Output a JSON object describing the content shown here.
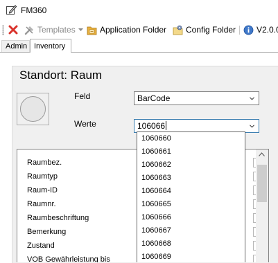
{
  "window": {
    "title": "FM360"
  },
  "toolbar": {
    "delete_icon": "red-x-icon",
    "templates_label": "Templates",
    "application_folder_label": "Application Folder",
    "config_folder_label": "Config Folder",
    "version_label": "V2.0.0"
  },
  "tabs": [
    {
      "label": "Admin",
      "active": false
    },
    {
      "label": "Inventory",
      "active": true
    }
  ],
  "main": {
    "heading": "Standort: Raum",
    "feld_label": "Feld",
    "feld_value": "BarCode",
    "werte_label": "Werte",
    "werte_value": "106066"
  },
  "grid": {
    "rows": [
      "Raumbez.",
      "Raumtyp",
      "Raum-ID",
      "Raumnr.",
      "Raumbeschriftung",
      "Bemerkung",
      "Zustand",
      "VOB Gewährleistung bis"
    ]
  },
  "dropdown": {
    "options": [
      "1060660",
      "1060661",
      "1060662",
      "1060663",
      "1060664",
      "1060665",
      "1060666",
      "1060667",
      "1060668",
      "1060669"
    ]
  },
  "colors": {
    "delete_red": "#d9322b",
    "focus_border": "#3c7fb1",
    "panel_bg": "#f0f0f0"
  }
}
